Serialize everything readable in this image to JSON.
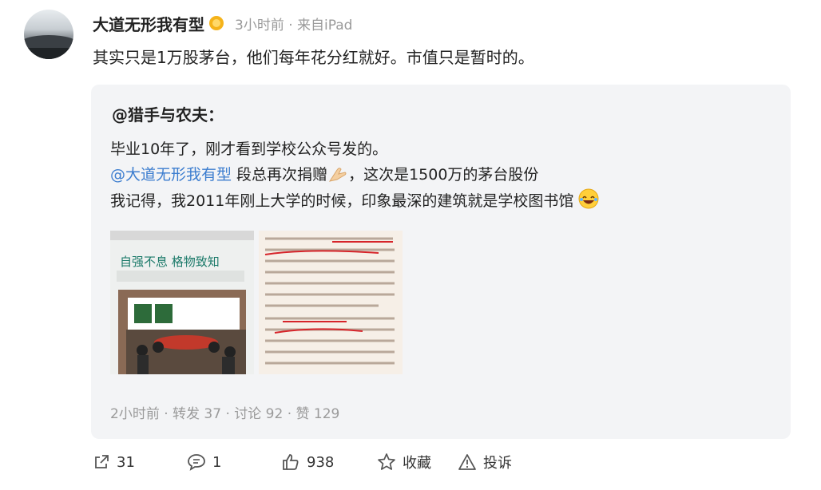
{
  "post": {
    "author": "大道无形我有型",
    "meta": "3小时前 · 来自iPad",
    "text": "其实只是1万股茅台，他们每年花分红就好。市值只是暂时的。"
  },
  "repost": {
    "author": "@猎手与农夫：",
    "line1": "毕业10年了，刚才看到学校公众号发的。",
    "mention": "@大道无形我有型",
    "line2_rest": " 段总再次捐赠",
    "line2_tail": "，这次是1500万的茅台股份",
    "line3": "我记得，我2011年刚上大学的时候，印象最深的建筑就是学校图书馆",
    "meta": "2小时前  · 转发 37 · 讨论 92 · 赞 129",
    "images": [
      {
        "type": "photo",
        "caption": "自强不息 格物致知"
      },
      {
        "type": "document-screenshot"
      }
    ]
  },
  "actions": {
    "share": "31",
    "comment": "1",
    "like": "938",
    "favorite": "收藏",
    "report": "投诉"
  },
  "colors": {
    "accent": "#3c7dcf",
    "meta": "#9a9a9a",
    "card": "#f3f4f6"
  }
}
